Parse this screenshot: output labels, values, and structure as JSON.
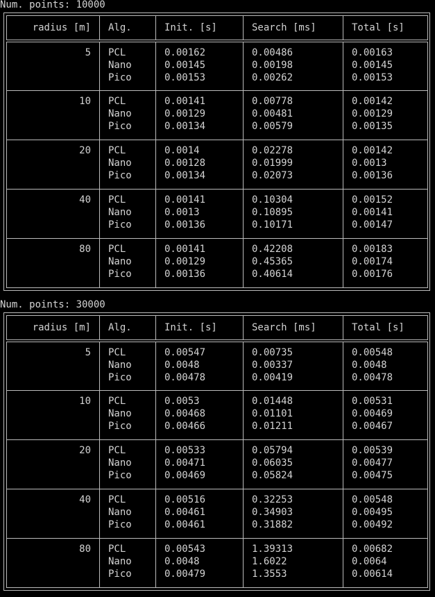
{
  "tables": [
    {
      "caption": "Num. points: 10000",
      "headers": [
        "radius [m]",
        "Alg.",
        "Init. [s]",
        "Search [ms]",
        "Total [s]"
      ],
      "groups": [
        {
          "radius": "5",
          "rows": [
            {
              "alg": "PCL",
              "init": "0.00162",
              "search": "0.00486",
              "total": "0.00163"
            },
            {
              "alg": "Nano",
              "init": "0.00145",
              "search": "0.00198",
              "total": "0.00145"
            },
            {
              "alg": "Pico",
              "init": "0.00153",
              "search": "0.00262",
              "total": "0.00153"
            }
          ]
        },
        {
          "radius": "10",
          "rows": [
            {
              "alg": "PCL",
              "init": "0.00141",
              "search": "0.00778",
              "total": "0.00142"
            },
            {
              "alg": "Nano",
              "init": "0.00129",
              "search": "0.00481",
              "total": "0.00129"
            },
            {
              "alg": "Pico",
              "init": "0.00134",
              "search": "0.00579",
              "total": "0.00135"
            }
          ]
        },
        {
          "radius": "20",
          "rows": [
            {
              "alg": "PCL",
              "init": "0.0014",
              "search": "0.02278",
              "total": "0.00142"
            },
            {
              "alg": "Nano",
              "init": "0.00128",
              "search": "0.01999",
              "total": "0.0013"
            },
            {
              "alg": "Pico",
              "init": "0.00134",
              "search": "0.02073",
              "total": "0.00136"
            }
          ]
        },
        {
          "radius": "40",
          "rows": [
            {
              "alg": "PCL",
              "init": "0.00141",
              "search": "0.10304",
              "total": "0.00152"
            },
            {
              "alg": "Nano",
              "init": "0.0013",
              "search": "0.10895",
              "total": "0.00141"
            },
            {
              "alg": "Pico",
              "init": "0.00136",
              "search": "0.10171",
              "total": "0.00147"
            }
          ]
        },
        {
          "radius": "80",
          "rows": [
            {
              "alg": "PCL",
              "init": "0.00141",
              "search": "0.42208",
              "total": "0.00183"
            },
            {
              "alg": "Nano",
              "init": "0.00129",
              "search": "0.45365",
              "total": "0.00174"
            },
            {
              "alg": "Pico",
              "init": "0.00136",
              "search": "0.40614",
              "total": "0.00176"
            }
          ]
        }
      ]
    },
    {
      "caption": "Num. points: 30000",
      "headers": [
        "radius [m]",
        "Alg.",
        "Init. [s]",
        "Search [ms]",
        "Total [s]"
      ],
      "groups": [
        {
          "radius": "5",
          "rows": [
            {
              "alg": "PCL",
              "init": "0.00547",
              "search": "0.00735",
              "total": "0.00548"
            },
            {
              "alg": "Nano",
              "init": "0.0048",
              "search": "0.00337",
              "total": "0.0048"
            },
            {
              "alg": "Pico",
              "init": "0.00478",
              "search": "0.00419",
              "total": "0.00478"
            }
          ]
        },
        {
          "radius": "10",
          "rows": [
            {
              "alg": "PCL",
              "init": "0.0053",
              "search": "0.01448",
              "total": "0.00531"
            },
            {
              "alg": "Nano",
              "init": "0.00468",
              "search": "0.01101",
              "total": "0.00469"
            },
            {
              "alg": "Pico",
              "init": "0.00466",
              "search": "0.01211",
              "total": "0.00467"
            }
          ]
        },
        {
          "radius": "20",
          "rows": [
            {
              "alg": "PCL",
              "init": "0.00533",
              "search": "0.05794",
              "total": "0.00539"
            },
            {
              "alg": "Nano",
              "init": "0.00471",
              "search": "0.06035",
              "total": "0.00477"
            },
            {
              "alg": "Pico",
              "init": "0.00469",
              "search": "0.05824",
              "total": "0.00475"
            }
          ]
        },
        {
          "radius": "40",
          "rows": [
            {
              "alg": "PCL",
              "init": "0.00516",
              "search": "0.32253",
              "total": "0.00548"
            },
            {
              "alg": "Nano",
              "init": "0.00461",
              "search": "0.34903",
              "total": "0.00495"
            },
            {
              "alg": "Pico",
              "init": "0.00461",
              "search": "0.31882",
              "total": "0.00492"
            }
          ]
        },
        {
          "radius": "80",
          "rows": [
            {
              "alg": "PCL",
              "init": "0.00543",
              "search": "1.39313",
              "total": "0.00682"
            },
            {
              "alg": "Nano",
              "init": "0.0048",
              "search": "1.6022",
              "total": "0.0064"
            },
            {
              "alg": "Pico",
              "init": "0.00479",
              "search": "1.3553",
              "total": "0.00614"
            }
          ]
        }
      ]
    }
  ]
}
